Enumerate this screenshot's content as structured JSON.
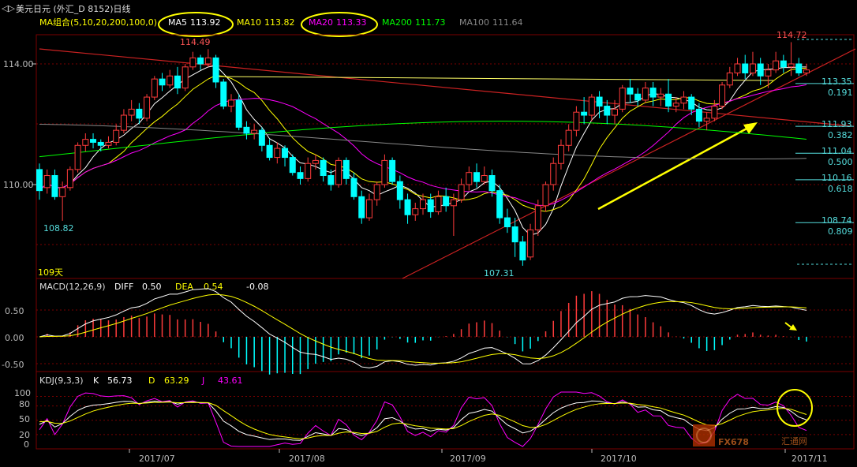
{
  "window": {
    "title_icon": "arrow-icon",
    "title": "美元日元 (外汇_D 8152)日线"
  },
  "ma_bar": {
    "label": "MA组合(5,10,20,200,100,0)",
    "items": [
      {
        "name": "MA5",
        "value": "113.92",
        "color": "#ffffff"
      },
      {
        "name": "MA10",
        "value": "113.82",
        "color": "#ffff00"
      },
      {
        "name": "MA20",
        "value": "113.33",
        "color": "#ff00ff"
      },
      {
        "name": "MA200",
        "value": "111.73",
        "color": "#00ff00"
      },
      {
        "name": "MA100",
        "value": "111.64",
        "color": "#888888"
      }
    ]
  },
  "price_axis": [
    "114.00",
    "110.00"
  ],
  "annotations": {
    "high_left": "114.49",
    "high_right": "114.72",
    "low_left": "108.82",
    "low_mid": "107.31",
    "days": "109天"
  },
  "fib_levels": [
    {
      "price": "113.35",
      "ratio": "0.191"
    },
    {
      "price": "111.93",
      "ratio": "0.382"
    },
    {
      "price": "111.04",
      "ratio": "0.500"
    },
    {
      "price": "110.16",
      "ratio": "0.618"
    },
    {
      "price": "108.74",
      "ratio": "0.809"
    }
  ],
  "macd": {
    "label": "MACD(12,26,9)",
    "diff_label": "DIFF",
    "diff": "0.50",
    "dea_label": "DEA",
    "dea": "0.54",
    "macd": "-0.08",
    "axis": [
      "0.50",
      "0.00",
      "-0.50"
    ]
  },
  "kdj": {
    "label": "KDJ(9,3,3)",
    "k_label": "K",
    "k": "56.73",
    "d_label": "D",
    "d": "63.29",
    "j_label": "J",
    "j": "43.61",
    "axis": [
      "100",
      "80",
      "50",
      "20",
      "0"
    ]
  },
  "x_axis": [
    "2017/07",
    "2017/08",
    "2017/09",
    "2017/10",
    "2017/11"
  ],
  "watermark": {
    "logo": "FX678",
    "brand": "汇通网"
  },
  "colors": {
    "up": "#ff3b3b",
    "down": "#00ffff",
    "grid": "#7a0000",
    "ma5": "#ffffff",
    "ma10": "#ffff00",
    "ma20": "#ff00ff",
    "ma200": "#00ff00",
    "ma100": "#888888",
    "highlight": "#ffff00"
  },
  "chart_data": {
    "type": "candlestick",
    "title": "美元日元 (外汇_D 8152)日线",
    "x_ticks": [
      "2017/07",
      "2017/08",
      "2017/09",
      "2017/10",
      "2017/11"
    ],
    "y_ticks": [
      110.0,
      114.0
    ],
    "ylim": [
      107.0,
      115.0
    ],
    "candles": [
      [
        110.5,
        109.8,
        110.7,
        109.5
      ],
      [
        109.9,
        110.3,
        110.5,
        109.7
      ],
      [
        110.3,
        109.6,
        110.5,
        109.5
      ],
      [
        109.6,
        109.9,
        110.1,
        108.8
      ],
      [
        109.9,
        110.5,
        110.6,
        109.8
      ],
      [
        110.5,
        111.3,
        111.4,
        110.4
      ],
      [
        111.3,
        111.5,
        111.7,
        111.1
      ],
      [
        111.5,
        111.4,
        111.7,
        111.2
      ],
      [
        111.4,
        111.3,
        111.5,
        111.1
      ],
      [
        111.3,
        111.4,
        111.6,
        111.2
      ],
      [
        111.4,
        111.8,
        112.0,
        111.3
      ],
      [
        111.8,
        112.3,
        112.5,
        111.7
      ],
      [
        112.3,
        112.5,
        112.8,
        112.1
      ],
      [
        112.5,
        112.2,
        112.7,
        112.0
      ],
      [
        112.2,
        112.9,
        113.0,
        112.1
      ],
      [
        112.9,
        113.5,
        113.6,
        112.8
      ],
      [
        113.5,
        113.3,
        113.7,
        113.1
      ],
      [
        113.3,
        113.6,
        113.8,
        113.2
      ],
      [
        113.6,
        113.2,
        113.9,
        113.0
      ],
      [
        113.2,
        113.9,
        114.0,
        113.1
      ],
      [
        113.9,
        114.2,
        114.4,
        113.8
      ],
      [
        114.2,
        114.0,
        114.3,
        113.8
      ],
      [
        114.0,
        114.2,
        114.49,
        113.9
      ],
      [
        114.2,
        113.4,
        114.3,
        113.2
      ],
      [
        113.4,
        112.6,
        113.5,
        112.5
      ],
      [
        112.6,
        112.8,
        113.0,
        112.4
      ],
      [
        112.8,
        111.9,
        113.0,
        111.8
      ],
      [
        111.9,
        111.7,
        112.1,
        111.5
      ],
      [
        111.7,
        111.8,
        112.0,
        111.5
      ],
      [
        111.8,
        111.3,
        111.9,
        111.1
      ],
      [
        111.3,
        110.9,
        111.5,
        110.8
      ],
      [
        110.9,
        111.2,
        111.4,
        110.7
      ],
      [
        111.2,
        110.9,
        111.3,
        110.6
      ],
      [
        110.9,
        110.4,
        111.0,
        110.3
      ],
      [
        110.4,
        110.2,
        110.6,
        110.0
      ],
      [
        110.2,
        110.7,
        110.9,
        110.1
      ],
      [
        110.7,
        110.8,
        111.0,
        110.5
      ],
      [
        110.8,
        110.3,
        110.9,
        110.1
      ],
      [
        110.3,
        110.0,
        110.5,
        109.8
      ],
      [
        110.0,
        110.8,
        110.9,
        109.9
      ],
      [
        110.8,
        110.2,
        110.9,
        110.0
      ],
      [
        110.2,
        109.6,
        110.4,
        109.5
      ],
      [
        109.6,
        108.9,
        109.8,
        108.7
      ],
      [
        108.9,
        109.5,
        109.7,
        108.8
      ],
      [
        109.5,
        110.0,
        110.1,
        109.3
      ],
      [
        110.0,
        110.8,
        111.0,
        109.9
      ],
      [
        110.8,
        110.1,
        110.9,
        110.0
      ],
      [
        110.1,
        109.5,
        110.3,
        109.2
      ],
      [
        109.5,
        109.0,
        109.7,
        108.7
      ],
      [
        109.0,
        109.2,
        109.4,
        108.8
      ],
      [
        109.2,
        109.5,
        109.7,
        109.0
      ],
      [
        109.5,
        109.1,
        109.7,
        108.9
      ],
      [
        109.1,
        109.6,
        109.8,
        109.0
      ],
      [
        109.6,
        109.3,
        109.9,
        109.1
      ],
      [
        109.3,
        109.5,
        109.7,
        108.3
      ],
      [
        109.5,
        110.0,
        110.2,
        109.4
      ],
      [
        110.0,
        110.4,
        110.6,
        109.8
      ],
      [
        110.4,
        110.1,
        110.7,
        109.9
      ],
      [
        110.1,
        110.3,
        110.6,
        110.0
      ],
      [
        110.3,
        109.8,
        110.5,
        109.6
      ],
      [
        109.8,
        108.9,
        110.0,
        108.7
      ],
      [
        108.9,
        108.6,
        109.2,
        108.4
      ],
      [
        108.6,
        108.1,
        108.9,
        107.6
      ],
      [
        108.1,
        107.5,
        108.3,
        107.31
      ],
      [
        107.6,
        108.5,
        108.7,
        107.5
      ],
      [
        108.5,
        109.3,
        109.5,
        108.3
      ],
      [
        109.3,
        110.0,
        110.1,
        109.1
      ],
      [
        110.0,
        110.7,
        110.9,
        109.8
      ],
      [
        110.7,
        111.3,
        111.5,
        110.5
      ],
      [
        111.3,
        111.8,
        112.0,
        111.1
      ],
      [
        111.8,
        112.4,
        112.6,
        111.6
      ],
      [
        112.4,
        112.3,
        112.9,
        112.0
      ],
      [
        112.3,
        112.9,
        113.0,
        112.1
      ],
      [
        112.9,
        112.6,
        113.1,
        112.2
      ],
      [
        112.6,
        112.3,
        112.8,
        112.0
      ],
      [
        112.3,
        112.5,
        112.8,
        112.0
      ],
      [
        112.5,
        113.2,
        113.3,
        112.4
      ],
      [
        113.2,
        113.0,
        113.5,
        112.7
      ],
      [
        113.0,
        112.8,
        113.2,
        112.6
      ],
      [
        112.8,
        113.2,
        113.4,
        112.7
      ],
      [
        113.2,
        112.9,
        113.4,
        112.6
      ],
      [
        112.9,
        113.0,
        113.2,
        112.6
      ],
      [
        113.0,
        112.6,
        113.5,
        112.4
      ],
      [
        112.6,
        112.7,
        112.9,
        112.4
      ],
      [
        112.7,
        112.9,
        113.1,
        112.5
      ],
      [
        112.9,
        112.5,
        113.0,
        112.3
      ],
      [
        112.5,
        112.1,
        112.7,
        111.9
      ],
      [
        112.1,
        112.2,
        112.4,
        111.8
      ],
      [
        112.2,
        112.6,
        112.8,
        112.1
      ],
      [
        112.6,
        113.3,
        113.4,
        112.5
      ],
      [
        113.3,
        113.7,
        113.9,
        113.2
      ],
      [
        113.7,
        114.0,
        114.2,
        113.6
      ],
      [
        114.0,
        113.7,
        114.3,
        113.5
      ],
      [
        113.7,
        114.0,
        114.4,
        113.6
      ],
      [
        114.0,
        113.6,
        114.2,
        113.3
      ],
      [
        113.6,
        113.8,
        114.0,
        113.2
      ],
      [
        113.8,
        114.1,
        114.4,
        113.7
      ],
      [
        114.1,
        113.9,
        114.3,
        113.7
      ],
      [
        113.9,
        114.0,
        114.72,
        113.6
      ],
      [
        114.0,
        113.7,
        114.2,
        113.6
      ],
      [
        113.7,
        113.8,
        114.0,
        113.6
      ]
    ],
    "fib_levels": [
      [
        113.35,
        0.191
      ],
      [
        111.93,
        0.382
      ],
      [
        111.04,
        0.5
      ],
      [
        110.16,
        0.618
      ],
      [
        108.74,
        0.809
      ]
    ],
    "macd": {
      "diff": 0.5,
      "dea": 0.54,
      "macd": -0.08,
      "ylim": [
        -0.6,
        0.9
      ]
    },
    "kdj": {
      "k": 56.73,
      "d": 63.29,
      "j": 43.61,
      "ylim": [
        0,
        100
      ]
    }
  }
}
